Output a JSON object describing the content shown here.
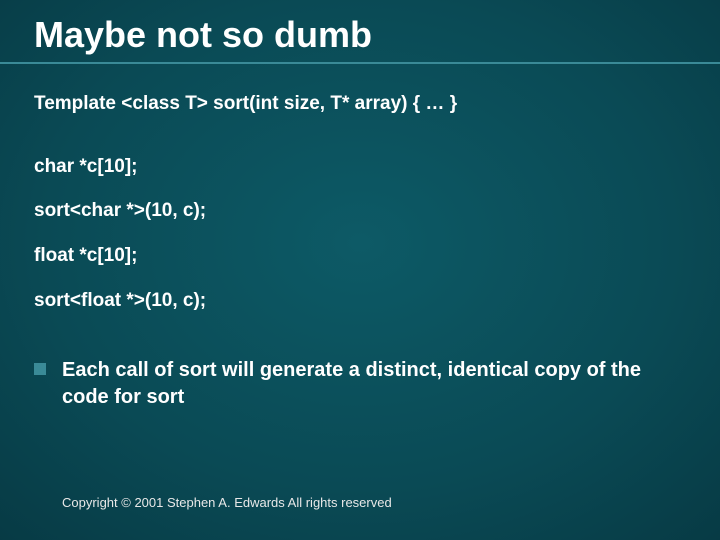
{
  "title": "Maybe not so dumb",
  "code": {
    "template": "Template <class T> sort(int size, T* array) { … }",
    "l1": "char *c[10];",
    "l2": "sort<char *>(10, c);",
    "l3": "float *c[10];",
    "l4": "sort<float *>(10, c);"
  },
  "bullet": "Each call of sort will generate a distinct, identical copy of the code for sort",
  "copyright": "Copyright © 2001 Stephen A. Edwards  All rights reserved"
}
